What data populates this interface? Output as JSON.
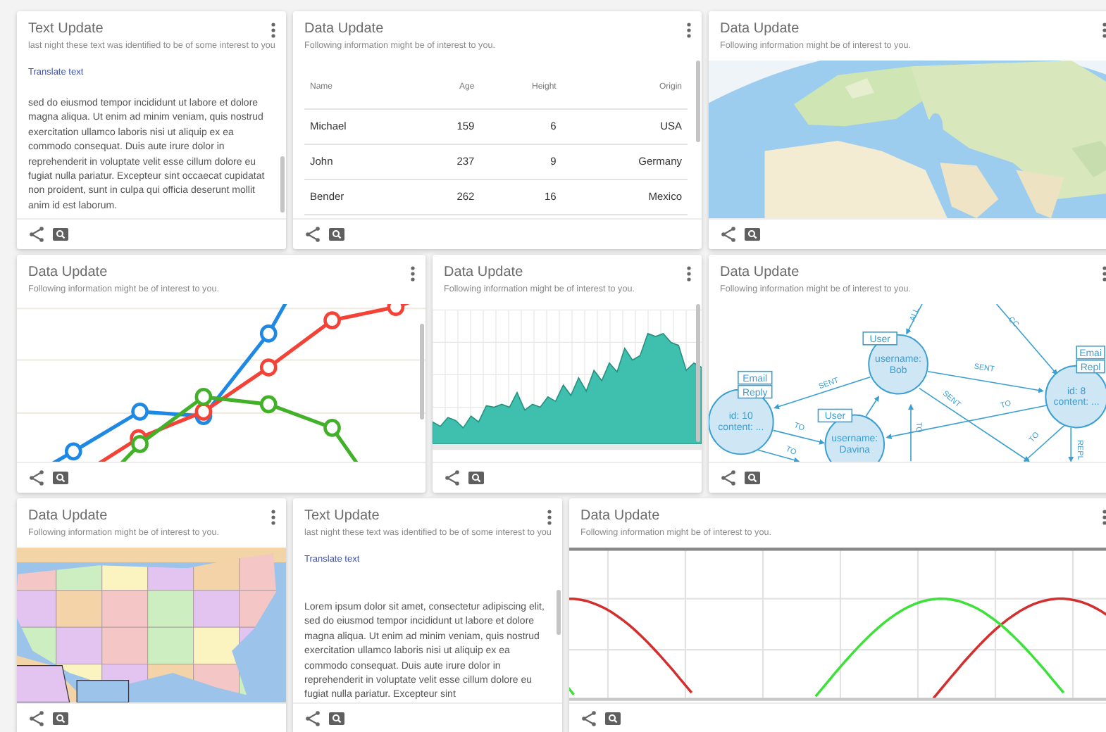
{
  "rows": [
    {
      "cards": [
        {
          "kind": "text",
          "title": "Text Update",
          "subtitle": "last night these text was identified to be of some interest to you",
          "link": "Translate text",
          "body": "sed do eiusmod tempor incididunt ut labore et dolore magna aliqua. Ut enim ad minim veniam, quis nostrud exercitation ullamco laboris nisi ut aliquip ex ea commodo consequat. Duis aute irure dolor in reprehenderit in voluptate velit esse cillum dolore eu fugiat nulla pariatur. Excepteur sint occaecat cupidatat non proident, sunt in culpa qui officia deserunt mollit anim id est laborum.",
          "scrollbar": true
        },
        {
          "kind": "table",
          "title": "Data Update",
          "subtitle": "Following information might be of interest to you.",
          "columns": [
            "Name",
            "Age",
            "Height",
            "Origin"
          ],
          "rows": [
            [
              "Michael",
              "159",
              "6",
              "USA"
            ],
            [
              "John",
              "237",
              "9",
              "Germany"
            ],
            [
              "Bender",
              "262",
              "16",
              "Mexico"
            ]
          ],
          "scrollbar": true
        },
        {
          "kind": "picture",
          "title": "Data Update",
          "subtitle": "Following information might be of interest to you."
        }
      ]
    },
    {
      "cards": [
        {
          "kind": "line-chart",
          "title": "Data Update",
          "subtitle": "Following information might be of interest to you.",
          "scrollbar": true
        },
        {
          "kind": "area-chart",
          "title": "Data Update",
          "subtitle": "Following information might be of interest to you.",
          "scrollbar": true
        },
        {
          "kind": "graph",
          "title": "Data Update",
          "subtitle": "Following information might be of interest to you.",
          "nodes": [
            {
              "tags": [
                "User"
              ],
              "lines": [
                "username:",
                "Bob"
              ]
            },
            {
              "tags": [
                "Email",
                "Reply"
              ],
              "lines": [
                "id: 10",
                "content: ..."
              ]
            },
            {
              "tags": [
                "User"
              ],
              "lines": [
                "username:",
                "Davina"
              ]
            },
            {
              "tags": [
                "Emai",
                "Repl"
              ],
              "lines": [
                "id: 8",
                "content: ..."
              ]
            }
          ],
          "edge_labels": [
            "ALL",
            "CC",
            "SENT",
            "SENT",
            "SENT",
            "TO",
            "TO",
            "TO",
            "TO",
            "TO",
            "REPL"
          ]
        }
      ]
    },
    {
      "cards": [
        {
          "kind": "picture",
          "title": "Data Update",
          "subtitle": "Following information might be of interest to you."
        },
        {
          "kind": "text",
          "title": "Text Update",
          "subtitle": "last night these text was identified to be of some interest to you",
          "link": "Translate text",
          "body": "Lorem ipsum dolor sit amet, consectetur adipiscing elit, sed do eiusmod tempor incididunt ut labore et dolore magna aliqua. Ut enim ad minim veniam, quis nostrud exercitation ullamco laboris nisi ut aliquip ex ea commodo consequat. Duis aute irure dolor in reprehenderit in voluptate velit esse cillum dolore eu fugiat nulla pariatur. Excepteur sint",
          "scrollbar": true
        },
        {
          "kind": "wave-chart",
          "title": "Data Update",
          "subtitle": "Following information might be of interest to you."
        }
      ]
    }
  ]
}
